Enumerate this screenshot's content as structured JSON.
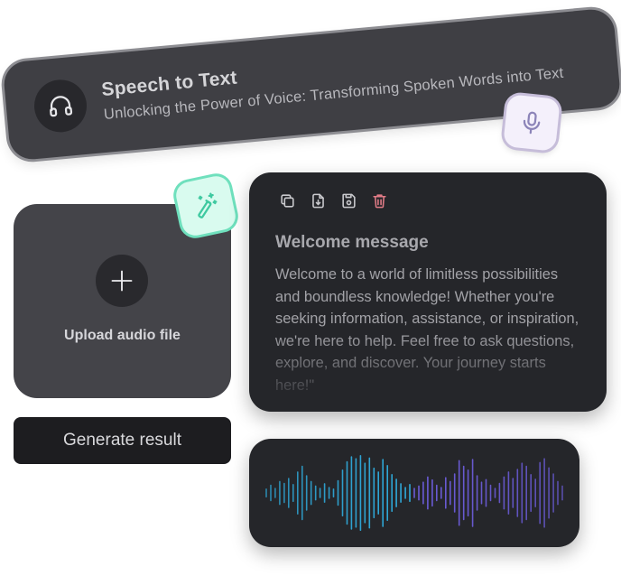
{
  "banner": {
    "title": "Speech to Text",
    "subtitle": "Unlocking the Power of Voice: Transforming Spoken Words into Text",
    "icon": "headphones-icon"
  },
  "badges": {
    "mic": "microphone-icon",
    "wand": "magic-wand-icon"
  },
  "upload": {
    "label": "Upload audio file",
    "icon": "plus-icon"
  },
  "generate_button": {
    "label": "Generate result"
  },
  "message": {
    "toolbar": [
      "copy-icon",
      "download-icon",
      "save-icon",
      "delete-icon"
    ],
    "title": "Welcome message",
    "body": "Welcome to a world of limitless possibilities and boundless knowledge! Whether you're seeking information, assistance, or inspiration, we're here to help. Feel free to ask questions, explore, and discover. Your journey starts here!\""
  },
  "waveform": {
    "levels": [
      0.1,
      0.2,
      0.12,
      0.3,
      0.25,
      0.38,
      0.22,
      0.55,
      0.7,
      0.45,
      0.3,
      0.18,
      0.12,
      0.24,
      0.14,
      0.1,
      0.32,
      0.6,
      0.82,
      0.95,
      0.9,
      0.98,
      0.78,
      0.92,
      0.65,
      0.55,
      0.88,
      0.72,
      0.48,
      0.36,
      0.24,
      0.14,
      0.22,
      0.12,
      0.18,
      0.28,
      0.42,
      0.34,
      0.2,
      0.14,
      0.4,
      0.3,
      0.5,
      0.85,
      0.7,
      0.6,
      0.88,
      0.45,
      0.28,
      0.35,
      0.2,
      0.12,
      0.25,
      0.42,
      0.55,
      0.38,
      0.62,
      0.78,
      0.7,
      0.48,
      0.36,
      0.8,
      0.9,
      0.66,
      0.5,
      0.3,
      0.18
    ],
    "colors": {
      "start": "#2fa8d8",
      "end": "#6a5bd6"
    }
  },
  "colors": {
    "delete": "#e07b86",
    "mint": "#3ec9a0",
    "lavender": "#8c84b8"
  }
}
